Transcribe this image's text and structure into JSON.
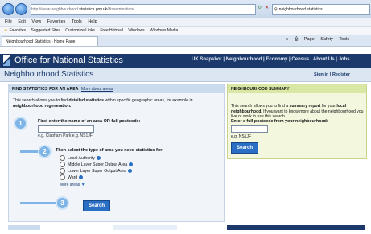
{
  "browser": {
    "url_prefix": "http://www.neighbourhood.",
    "url_domain": "statistics.gov.uk",
    "url_suffix": "/dissemination/",
    "search_text": "neighbourhood statistics",
    "menu": [
      "File",
      "Edit",
      "View",
      "Favorites",
      "Tools",
      "Help"
    ],
    "favorites_label": "Favorites",
    "favorites_items": [
      "Suggested Sites",
      "Customize Links",
      "Free Hotmail",
      "Windows",
      "Windows Media"
    ],
    "tab_title": "Neighbourhood Statistics - Home Page",
    "tools": [
      "Page",
      "Safety",
      "Tools"
    ]
  },
  "site": {
    "title": "Office for National Statistics",
    "nav": [
      "UK Snapshot",
      "Neighbourhood",
      "Economy",
      "Census",
      "About Us",
      "Jobs"
    ],
    "section_title": "Neighbourhood Statistics",
    "sign_in": "Sign in",
    "register": "Register"
  },
  "find_panel": {
    "title": "FIND STATISTICS FOR AN AREA",
    "more_about": "More about areas",
    "desc_1": "This search allows you to find ",
    "desc_bold_1": "detailed statistics",
    "desc_2": " within specific geographic areas, for example in ",
    "desc_bold_2": "neighbourhood regeneration.",
    "step1": "First enter the name of an area OR full postcode:",
    "step1_eg": "e.g. Clapham Park e.g. NS1JF",
    "step2": "Then select the type of area you need statistics for:",
    "options": [
      "Local Authority",
      "Middle Layer Super Output Area",
      "Lower Layer Super Output Area",
      "Ward"
    ],
    "more_areas": "More areas",
    "step_numbers": [
      "1",
      "2",
      "3"
    ],
    "search_label": "Search"
  },
  "summary_panel": {
    "title": "NEIGHBOURHOOD SUMMARY",
    "desc_1": "This search allows you to find a ",
    "desc_bold_1": "summary report",
    "desc_2": " for your ",
    "desc_bold_2": "local neighbourhood.",
    "desc_3": " If you want to know more about the neighbourhood you live or work in use this search.",
    "label": "Enter a full postcode from your neighbourhood:",
    "eg": "e.g. NS1JF",
    "search_label": "Search"
  }
}
